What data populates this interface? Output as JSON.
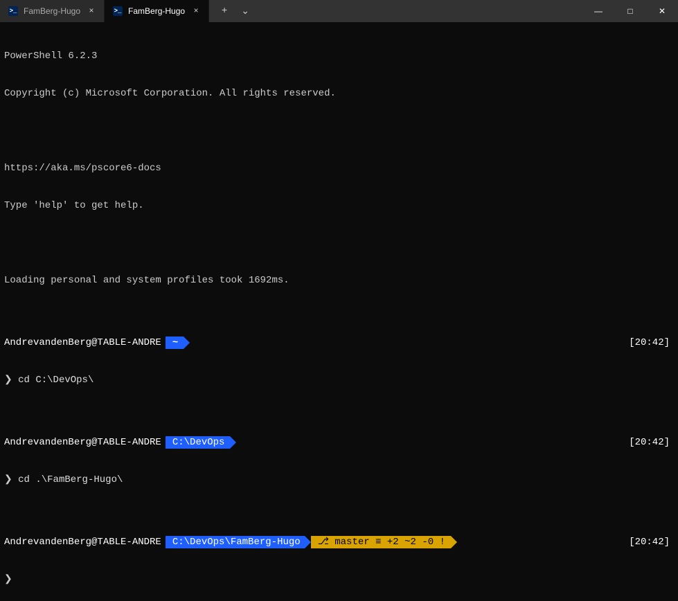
{
  "tabs": [
    {
      "title": "FamBerg-Hugo",
      "active": false
    },
    {
      "title": "FamBerg-Hugo",
      "active": true
    }
  ],
  "window": {
    "newTab": "+",
    "dropdown": "⌄",
    "minimize": "—",
    "maximize": "□",
    "close": "✕"
  },
  "header": {
    "line1": "PowerShell 6.2.3",
    "line2": "Copyright (c) Microsoft Corporation. All rights reserved.",
    "line3": "https://aka.ms/pscore6-docs",
    "line4": "Type 'help' to get help.",
    "line5": "Loading personal and system profiles took 1692ms."
  },
  "userHost": "AndrevandenBerg@TABLE-ANDRE",
  "time": "[20:42]",
  "promptSym": "❯",
  "tildeSym": "~",
  "cmd1": "cd C:\\DevOps\\",
  "path1": "C:\\DevOps",
  "cmd2": "cd .\\FamBerg-Hugo\\",
  "path2": "C:\\DevOps\\FamBerg-Hugo",
  "git": {
    "branchIcon": "⎇",
    "branch": "master",
    "equiv": "≡",
    "ahead": "+2",
    "behind": "~2",
    "stash": "-0",
    "dirty": "!"
  },
  "colors": {
    "blue": "#1f5fff",
    "yellow": "#d9a400",
    "bg": "#0c0c0c"
  }
}
